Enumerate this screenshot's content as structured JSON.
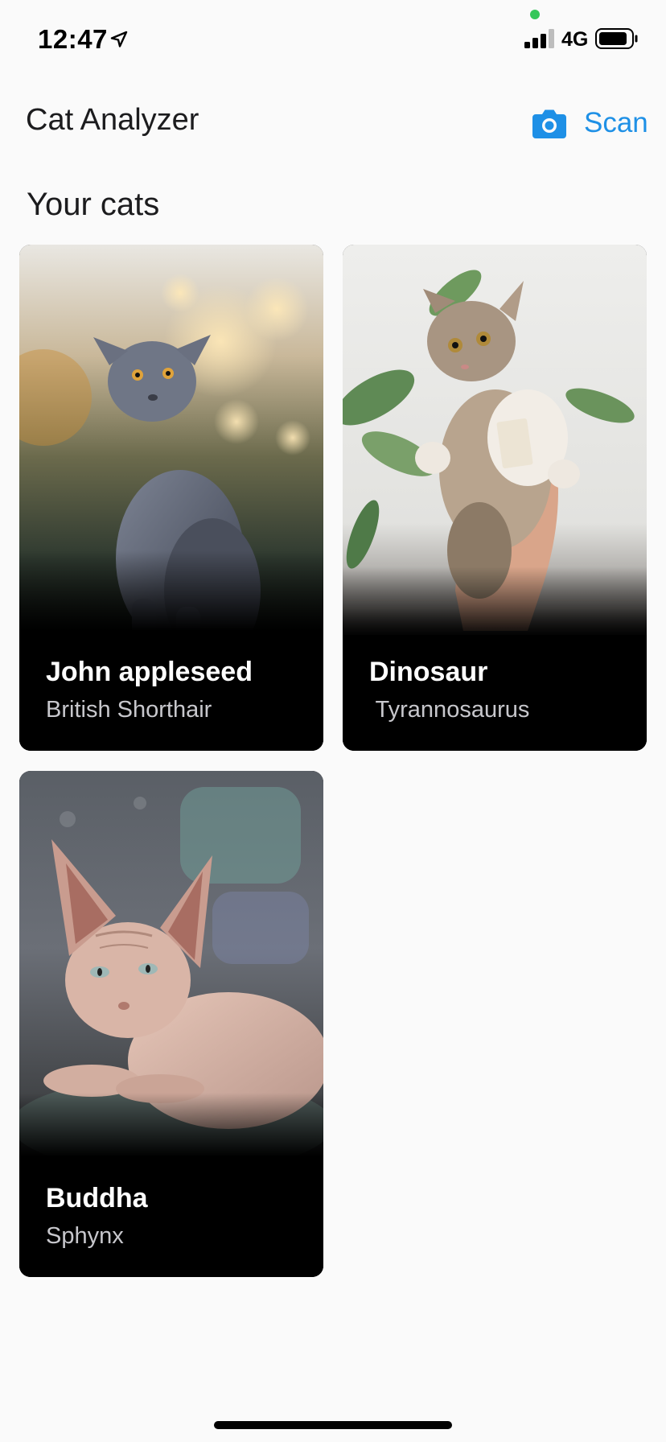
{
  "status_bar": {
    "time": "12:47",
    "network": "4G",
    "location_icon": "location-arrow-icon",
    "signal_icon": "cellular-signal-icon",
    "battery_icon": "battery-icon",
    "mic_indicator_color": "#34c759"
  },
  "header": {
    "title": "Cat Analyzer",
    "scan_label": "Scan",
    "scan_icon": "camera-icon",
    "accent_color": "#1e90e6"
  },
  "section": {
    "title": "Your cats"
  },
  "cats": [
    {
      "name": "John appleseed",
      "breed": "British Shorthair",
      "photo": "grey-british-shorthair-cat-photo"
    },
    {
      "name": "Dinosaur",
      "breed": " Tyrannosaurus",
      "photo": "tabby-kitten-held-in-hand-photo"
    },
    {
      "name": "Buddha",
      "breed": "Sphynx",
      "photo": "sphynx-cat-lying-photo"
    }
  ]
}
